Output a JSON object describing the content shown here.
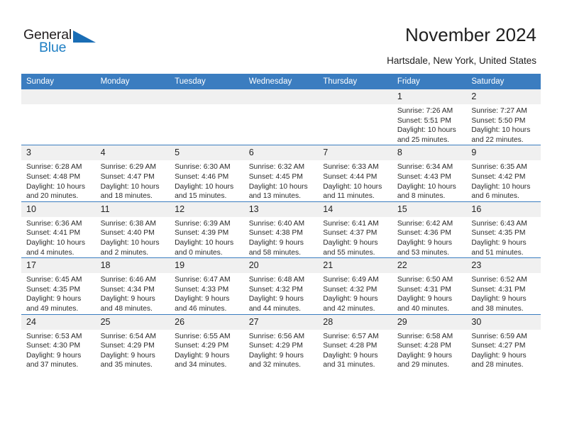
{
  "brand": {
    "name_top": "General",
    "name_bottom": "Blue",
    "accent_color": "#1a6db5"
  },
  "header": {
    "title": "November 2024",
    "location": "Hartsdale, New York, United States"
  },
  "theme": {
    "header_bg": "#3b7dc0",
    "daynum_bg": "#f0f0f0",
    "row_divider": "#3b7dc0"
  },
  "weekdays": [
    "Sunday",
    "Monday",
    "Tuesday",
    "Wednesday",
    "Thursday",
    "Friday",
    "Saturday"
  ],
  "weeks": [
    [
      {
        "day": "",
        "empty": true
      },
      {
        "day": "",
        "empty": true
      },
      {
        "day": "",
        "empty": true
      },
      {
        "day": "",
        "empty": true
      },
      {
        "day": "",
        "empty": true
      },
      {
        "day": "1",
        "sunrise": "Sunrise: 7:26 AM",
        "sunset": "Sunset: 5:51 PM",
        "daylight": "Daylight: 10 hours and 25 minutes."
      },
      {
        "day": "2",
        "sunrise": "Sunrise: 7:27 AM",
        "sunset": "Sunset: 5:50 PM",
        "daylight": "Daylight: 10 hours and 22 minutes."
      }
    ],
    [
      {
        "day": "3",
        "sunrise": "Sunrise: 6:28 AM",
        "sunset": "Sunset: 4:48 PM",
        "daylight": "Daylight: 10 hours and 20 minutes."
      },
      {
        "day": "4",
        "sunrise": "Sunrise: 6:29 AM",
        "sunset": "Sunset: 4:47 PM",
        "daylight": "Daylight: 10 hours and 18 minutes."
      },
      {
        "day": "5",
        "sunrise": "Sunrise: 6:30 AM",
        "sunset": "Sunset: 4:46 PM",
        "daylight": "Daylight: 10 hours and 15 minutes."
      },
      {
        "day": "6",
        "sunrise": "Sunrise: 6:32 AM",
        "sunset": "Sunset: 4:45 PM",
        "daylight": "Daylight: 10 hours and 13 minutes."
      },
      {
        "day": "7",
        "sunrise": "Sunrise: 6:33 AM",
        "sunset": "Sunset: 4:44 PM",
        "daylight": "Daylight: 10 hours and 11 minutes."
      },
      {
        "day": "8",
        "sunrise": "Sunrise: 6:34 AM",
        "sunset": "Sunset: 4:43 PM",
        "daylight": "Daylight: 10 hours and 8 minutes."
      },
      {
        "day": "9",
        "sunrise": "Sunrise: 6:35 AM",
        "sunset": "Sunset: 4:42 PM",
        "daylight": "Daylight: 10 hours and 6 minutes."
      }
    ],
    [
      {
        "day": "10",
        "sunrise": "Sunrise: 6:36 AM",
        "sunset": "Sunset: 4:41 PM",
        "daylight": "Daylight: 10 hours and 4 minutes."
      },
      {
        "day": "11",
        "sunrise": "Sunrise: 6:38 AM",
        "sunset": "Sunset: 4:40 PM",
        "daylight": "Daylight: 10 hours and 2 minutes."
      },
      {
        "day": "12",
        "sunrise": "Sunrise: 6:39 AM",
        "sunset": "Sunset: 4:39 PM",
        "daylight": "Daylight: 10 hours and 0 minutes."
      },
      {
        "day": "13",
        "sunrise": "Sunrise: 6:40 AM",
        "sunset": "Sunset: 4:38 PM",
        "daylight": "Daylight: 9 hours and 58 minutes."
      },
      {
        "day": "14",
        "sunrise": "Sunrise: 6:41 AM",
        "sunset": "Sunset: 4:37 PM",
        "daylight": "Daylight: 9 hours and 55 minutes."
      },
      {
        "day": "15",
        "sunrise": "Sunrise: 6:42 AM",
        "sunset": "Sunset: 4:36 PM",
        "daylight": "Daylight: 9 hours and 53 minutes."
      },
      {
        "day": "16",
        "sunrise": "Sunrise: 6:43 AM",
        "sunset": "Sunset: 4:35 PM",
        "daylight": "Daylight: 9 hours and 51 minutes."
      }
    ],
    [
      {
        "day": "17",
        "sunrise": "Sunrise: 6:45 AM",
        "sunset": "Sunset: 4:35 PM",
        "daylight": "Daylight: 9 hours and 49 minutes."
      },
      {
        "day": "18",
        "sunrise": "Sunrise: 6:46 AM",
        "sunset": "Sunset: 4:34 PM",
        "daylight": "Daylight: 9 hours and 48 minutes."
      },
      {
        "day": "19",
        "sunrise": "Sunrise: 6:47 AM",
        "sunset": "Sunset: 4:33 PM",
        "daylight": "Daylight: 9 hours and 46 minutes."
      },
      {
        "day": "20",
        "sunrise": "Sunrise: 6:48 AM",
        "sunset": "Sunset: 4:32 PM",
        "daylight": "Daylight: 9 hours and 44 minutes."
      },
      {
        "day": "21",
        "sunrise": "Sunrise: 6:49 AM",
        "sunset": "Sunset: 4:32 PM",
        "daylight": "Daylight: 9 hours and 42 minutes."
      },
      {
        "day": "22",
        "sunrise": "Sunrise: 6:50 AM",
        "sunset": "Sunset: 4:31 PM",
        "daylight": "Daylight: 9 hours and 40 minutes."
      },
      {
        "day": "23",
        "sunrise": "Sunrise: 6:52 AM",
        "sunset": "Sunset: 4:31 PM",
        "daylight": "Daylight: 9 hours and 38 minutes."
      }
    ],
    [
      {
        "day": "24",
        "sunrise": "Sunrise: 6:53 AM",
        "sunset": "Sunset: 4:30 PM",
        "daylight": "Daylight: 9 hours and 37 minutes."
      },
      {
        "day": "25",
        "sunrise": "Sunrise: 6:54 AM",
        "sunset": "Sunset: 4:29 PM",
        "daylight": "Daylight: 9 hours and 35 minutes."
      },
      {
        "day": "26",
        "sunrise": "Sunrise: 6:55 AM",
        "sunset": "Sunset: 4:29 PM",
        "daylight": "Daylight: 9 hours and 34 minutes."
      },
      {
        "day": "27",
        "sunrise": "Sunrise: 6:56 AM",
        "sunset": "Sunset: 4:29 PM",
        "daylight": "Daylight: 9 hours and 32 minutes."
      },
      {
        "day": "28",
        "sunrise": "Sunrise: 6:57 AM",
        "sunset": "Sunset: 4:28 PM",
        "daylight": "Daylight: 9 hours and 31 minutes."
      },
      {
        "day": "29",
        "sunrise": "Sunrise: 6:58 AM",
        "sunset": "Sunset: 4:28 PM",
        "daylight": "Daylight: 9 hours and 29 minutes."
      },
      {
        "day": "30",
        "sunrise": "Sunrise: 6:59 AM",
        "sunset": "Sunset: 4:27 PM",
        "daylight": "Daylight: 9 hours and 28 minutes."
      }
    ]
  ]
}
